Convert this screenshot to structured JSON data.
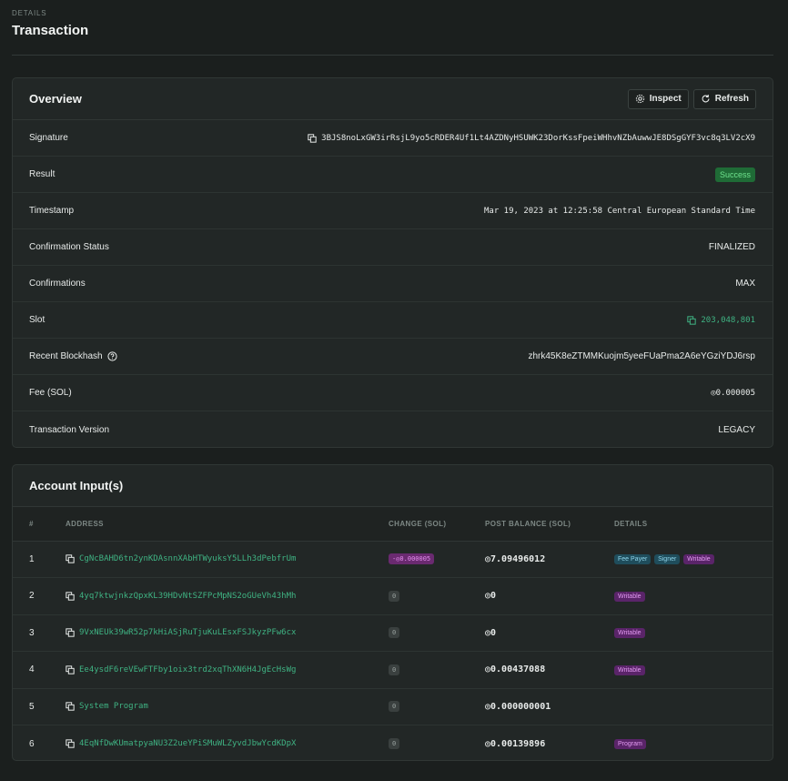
{
  "header": {
    "pretitle": "DETAILS",
    "title": "Transaction"
  },
  "overview": {
    "title": "Overview",
    "inspect_label": "Inspect",
    "refresh_label": "Refresh",
    "rows": [
      {
        "label": "Signature",
        "value": "3BJS8noLxGW3irRsjL9yo5cRDER4Uf1Lt4AZDNyHSUWK23DorKssFpeiWHhvNZbAuwwJE8DSgGYF3vc8q3LV2cX9"
      },
      {
        "label": "Result",
        "value": "Success"
      },
      {
        "label": "Timestamp",
        "value": "Mar 19, 2023 at 12:25:58 Central European Standard Time"
      },
      {
        "label": "Confirmation Status",
        "value": "FINALIZED"
      },
      {
        "label": "Confirmations",
        "value": "MAX"
      },
      {
        "label": "Slot",
        "value": "203,048,801"
      },
      {
        "label": "Recent Blockhash",
        "value": "zhrk45K8eZTMMKuojm5yeeFUaPma2A6eYGziYDJ6rsp"
      },
      {
        "label": "Fee (SOL)",
        "value": "◎0.000005"
      },
      {
        "label": "Transaction Version",
        "value": "LEGACY"
      }
    ]
  },
  "accounts": {
    "title": "Account Input(s)",
    "columns": [
      "#",
      "ADDRESS",
      "CHANGE (SOL)",
      "POST BALANCE (SOL)",
      "DETAILS"
    ],
    "rows": [
      {
        "num": "1",
        "address": "CgNcBAHD6tn2ynKDAsnnXAbHTWyuksY5LLh3dPebfrUm",
        "change": "-◎0.000005",
        "post": "◎7.09496012",
        "details": [
          "Fee Payer",
          "Signer",
          "Writable"
        ]
      },
      {
        "num": "2",
        "address": "4yq7ktwjnkzQpxKL39HDvNtSZFPcMpNS2oGUeVh43hMh",
        "change": "0",
        "post": "◎0",
        "details": [
          "Writable"
        ]
      },
      {
        "num": "3",
        "address": "9VxNEUk39wR52p7kHiASjRuTjuKuLEsxFSJkyzPFw6cx",
        "change": "0",
        "post": "◎0",
        "details": [
          "Writable"
        ]
      },
      {
        "num": "4",
        "address": "Ee4ysdF6reVEwFTFby1oix3trd2xqThXN6H4JgEcHsWg",
        "change": "0",
        "post": "◎0.00437088",
        "details": [
          "Writable"
        ]
      },
      {
        "num": "5",
        "address": "System Program",
        "change": "0",
        "post": "◎0.000000001",
        "details": []
      },
      {
        "num": "6",
        "address": "4EqNfDwKUmatpyaNU3Z2ueYPiSMuWLZyvdJbwYcdKDpX",
        "change": "0",
        "post": "◎0.00139896",
        "details": [
          "Program"
        ]
      }
    ]
  },
  "colors": {
    "accent_green": "#3fb383",
    "success_bg": "#1f6b36",
    "writable_bg": "#5a2469",
    "feepayer_bg": "#1f4d5c"
  },
  "icons": {
    "copy": "copy-icon",
    "help": "help-icon",
    "inspect": "gear-icon",
    "refresh": "refresh-icon"
  }
}
